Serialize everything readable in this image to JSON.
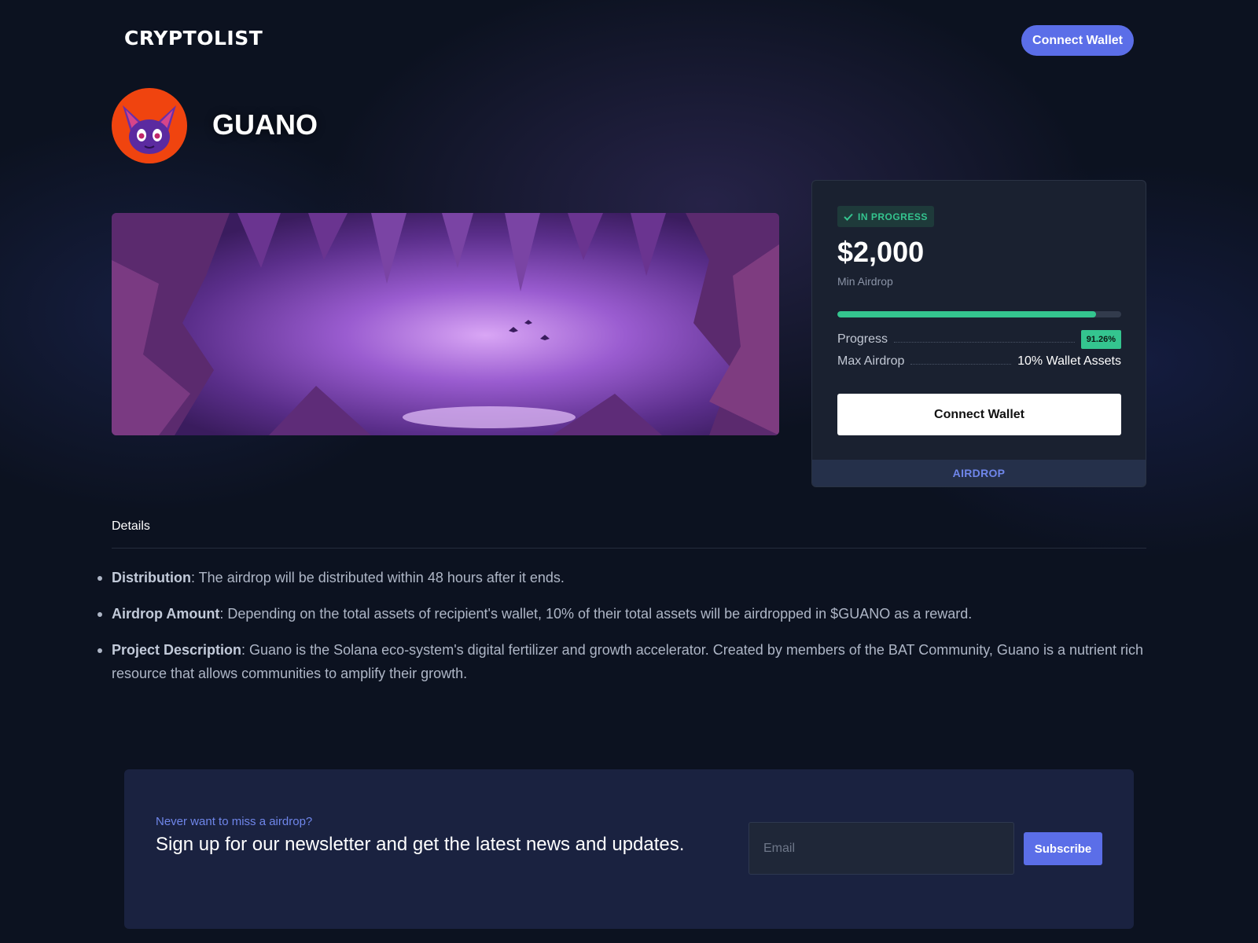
{
  "header": {
    "logo": "CRYPTOLIST",
    "connect_label": "Connect Wallet"
  },
  "project": {
    "name": "GUANO",
    "avatar_icon": "bat-mascot-icon"
  },
  "card": {
    "status": "IN PROGRESS",
    "status_icon": "check-icon",
    "amount": "$2,000",
    "amount_label": "Min Airdrop",
    "progress": 0.9126,
    "progress_label": "Progress",
    "progress_value": "91.26%",
    "max_label": "Max Airdrop",
    "max_value": "10% Wallet Assets",
    "connect_label": "Connect Wallet",
    "footer": "AIRDROP"
  },
  "details": {
    "tab": "Details",
    "items": [
      {
        "title": "Distribution",
        "text": ": The airdrop will be distributed within 48 hours after it ends."
      },
      {
        "title": "Airdrop Amount",
        "text": ": Depending on the total assets of recipient's wallet, 10% of their total assets will be airdropped in $GUANO as a reward."
      },
      {
        "title": "Project Description",
        "text": ": Guano is the Solana eco-system's digital fertilizer and growth accelerator. Created by members of the BAT Community, Guano is a nutrient rich resource that allows communities to amplify their growth."
      }
    ]
  },
  "newsletter": {
    "kicker": "Never want to miss a airdrop?",
    "title": "Sign up for our newsletter and get the latest news and updates.",
    "email_placeholder": "Email",
    "subscribe_label": "Subscribe"
  },
  "colors": {
    "accent": "#5b6ee8",
    "success": "#34c58f",
    "background": "#0c1220"
  }
}
